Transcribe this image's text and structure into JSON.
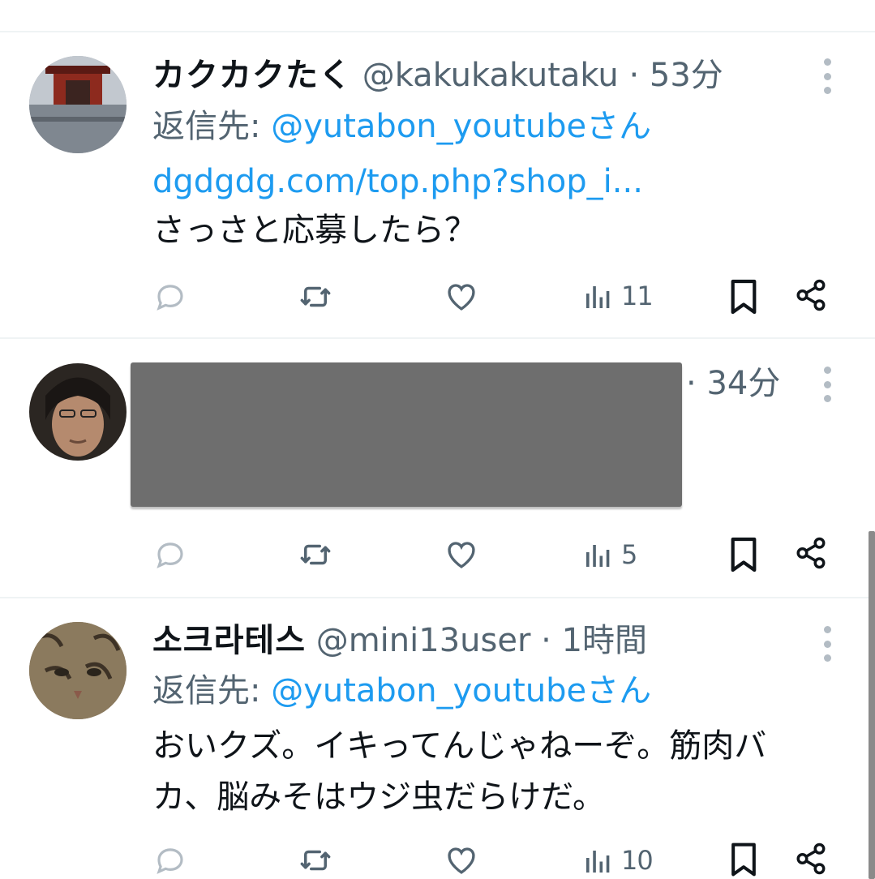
{
  "colors": {
    "accent": "#1d9bf0",
    "muted": "#536471",
    "text": "#0f1419",
    "divider": "#eff3f4"
  },
  "tweets": [
    {
      "name": "カクカクたく",
      "handle": "@kakukakutaku",
      "separator": "·",
      "time": "53分",
      "reply_label": "返信先:",
      "reply_to": "@yutabon_youtubeさん",
      "link_text": "dgdgdg.com/top.php?shop_i...",
      "body": "さっさと応募したら？",
      "actions": {
        "reply": "",
        "retweet": "",
        "like": "",
        "views": "11"
      }
    },
    {
      "separator": "·",
      "time": "34分",
      "redacted": true,
      "actions": {
        "reply": "",
        "retweet": "",
        "like": "",
        "views": "5"
      }
    },
    {
      "name": "소크라테스",
      "handle": "@mini13user",
      "separator": "·",
      "time": "1時間",
      "reply_label": "返信先:",
      "reply_to": "@yutabon_youtubeさん",
      "body_line1": "おいクズ。イキってんじゃねーぞ。筋肉バ",
      "body_line2": "カ、脳みそはウジ虫だらけだ。",
      "actions": {
        "reply": "",
        "retweet": "",
        "like": "",
        "views": "10"
      }
    }
  ],
  "icons": [
    "reply-icon",
    "retweet-icon",
    "like-icon",
    "views-icon",
    "bookmark-icon",
    "share-icon",
    "more-icon"
  ]
}
